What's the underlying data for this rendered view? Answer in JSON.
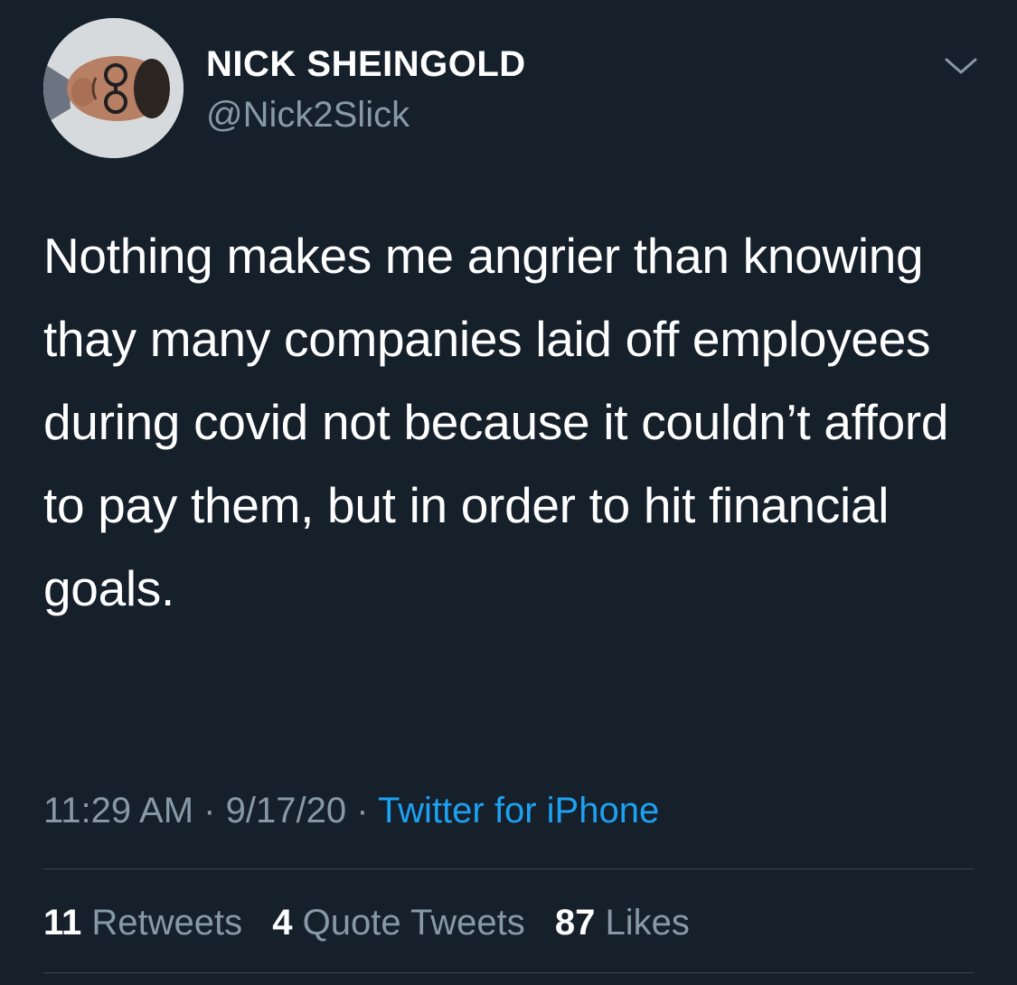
{
  "tweet": {
    "author": {
      "name": "NICK SHEINGOLD",
      "handle": "@Nick2Slick"
    },
    "text": "Nothing makes me angrier than knowing thay many companies laid off employees during covid not because it couldn’t afford to pay them, but in order to hit financial goals.",
    "meta": {
      "time": "11:29 AM",
      "separator": "·",
      "date": "9/17/20",
      "source": "Twitter for iPhone"
    },
    "stats": {
      "retweets_count": "11",
      "retweets_label": "Retweets",
      "quotes_count": "4",
      "quotes_label": "Quote Tweets",
      "likes_count": "87",
      "likes_label": "Likes"
    }
  },
  "icons": {
    "avatar": "profile-photo",
    "menu": "chevron-down-icon"
  },
  "colors": {
    "background": "#15202b",
    "primary_text": "#ffffff",
    "secondary_text": "#8899a6",
    "link": "#1da1f2",
    "divider": "#38444d"
  }
}
